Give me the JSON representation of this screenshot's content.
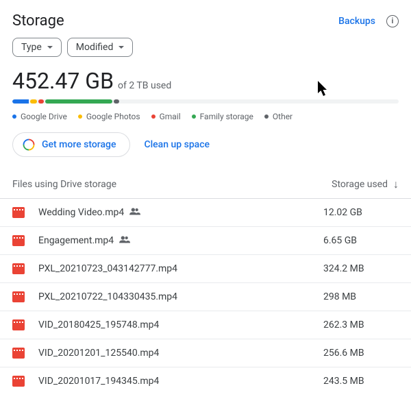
{
  "header": {
    "title": "Storage",
    "backups_label": "Backups"
  },
  "filters": {
    "type": "Type",
    "modified": "Modified"
  },
  "usage": {
    "amount": "452.47 GB",
    "total": "of 2 TB used"
  },
  "legend": {
    "drive": "Google Drive",
    "photos": "Google Photos",
    "gmail": "Gmail",
    "family": "Family storage",
    "other": "Other"
  },
  "actions": {
    "get_more": "Get more storage",
    "cleanup": "Clean up space"
  },
  "columns": {
    "name": "Files using Drive storage",
    "size": "Storage used"
  },
  "files": [
    {
      "name": "Wedding Video.mp4",
      "size": "12.02 GB",
      "shared": true
    },
    {
      "name": "Engagement.mp4",
      "size": "6.65 GB",
      "shared": true
    },
    {
      "name": "PXL_20210723_043142777.mp4",
      "size": "324.2 MB",
      "shared": false
    },
    {
      "name": "PXL_20210722_104330435.mp4",
      "size": "298 MB",
      "shared": false
    },
    {
      "name": "VID_20180425_195748.mp4",
      "size": "262.3 MB",
      "shared": false
    },
    {
      "name": "VID_20201201_125540.mp4",
      "size": "256.6 MB",
      "shared": false
    },
    {
      "name": "VID_20201017_194345.mp4",
      "size": "243.5 MB",
      "shared": false
    }
  ]
}
